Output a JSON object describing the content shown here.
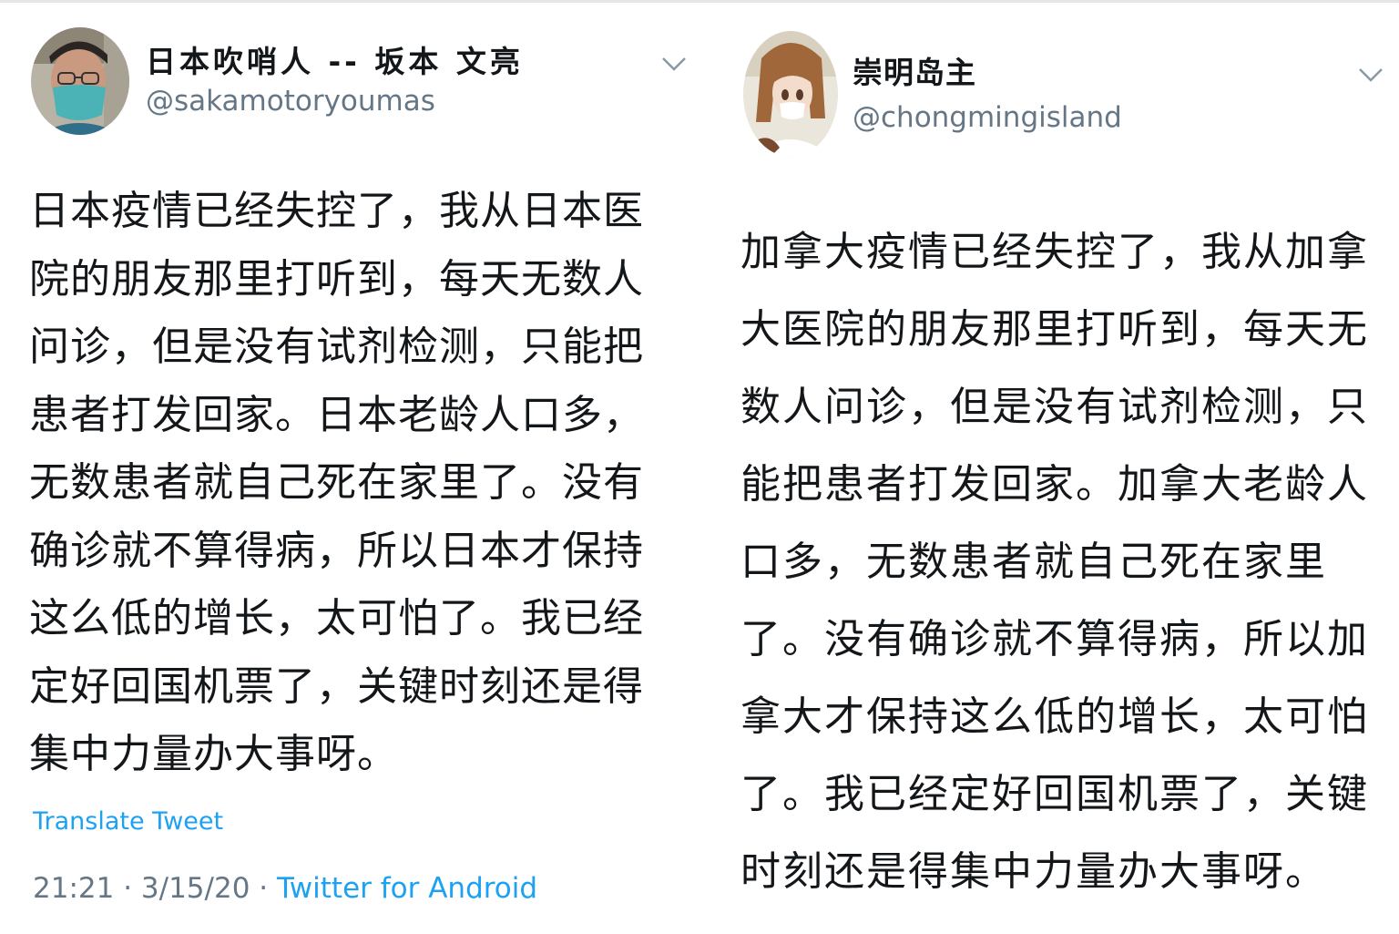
{
  "left_tweet": {
    "display_name": "日本吹哨人 -- 坂本 文亮",
    "handle": "@sakamotoryoumas",
    "text": "日本疫情已经失控了，我从日本医\n院的朋友那里打听到，每天无数人\n问诊，但是没有试剂检测，只能把\n患者打发回家。日本老龄人口多，\n无数患者就自己死在家里了。没有\n确诊就不算得病，所以日本才保持\n这么低的增长，太可怕了。我已经\n定好回国机票了，关键时刻还是得\n集中力量办大事呀。",
    "translate_label": "Translate Tweet",
    "time": "21:21",
    "date": "3/15/20",
    "separator": " · ",
    "source_app": "Twitter for Android",
    "menu_icon": "chevron-down-icon"
  },
  "right_tweet": {
    "display_name": "崇明岛主",
    "handle": "@chongmingisland",
    "text": "加拿大疫情已经失控了，我从加拿\n大医院的朋友那里打听到，每天无\n数人问诊，但是没有试剂检测，只\n能把患者打发回家。加拿大老龄人\n口多，无数患者就自己死在家里\n了。没有确诊就不算得病，所以加\n拿大才保持这么低的增长，太可怕\n了。我已经定好回国机票了，关键\n时刻还是得集中力量办大事呀。",
    "menu_icon": "chevron-down-icon"
  },
  "colors": {
    "text_primary": "#14171a",
    "text_secondary": "#657786",
    "link_blue": "#1da1f2",
    "background": "#ffffff"
  }
}
